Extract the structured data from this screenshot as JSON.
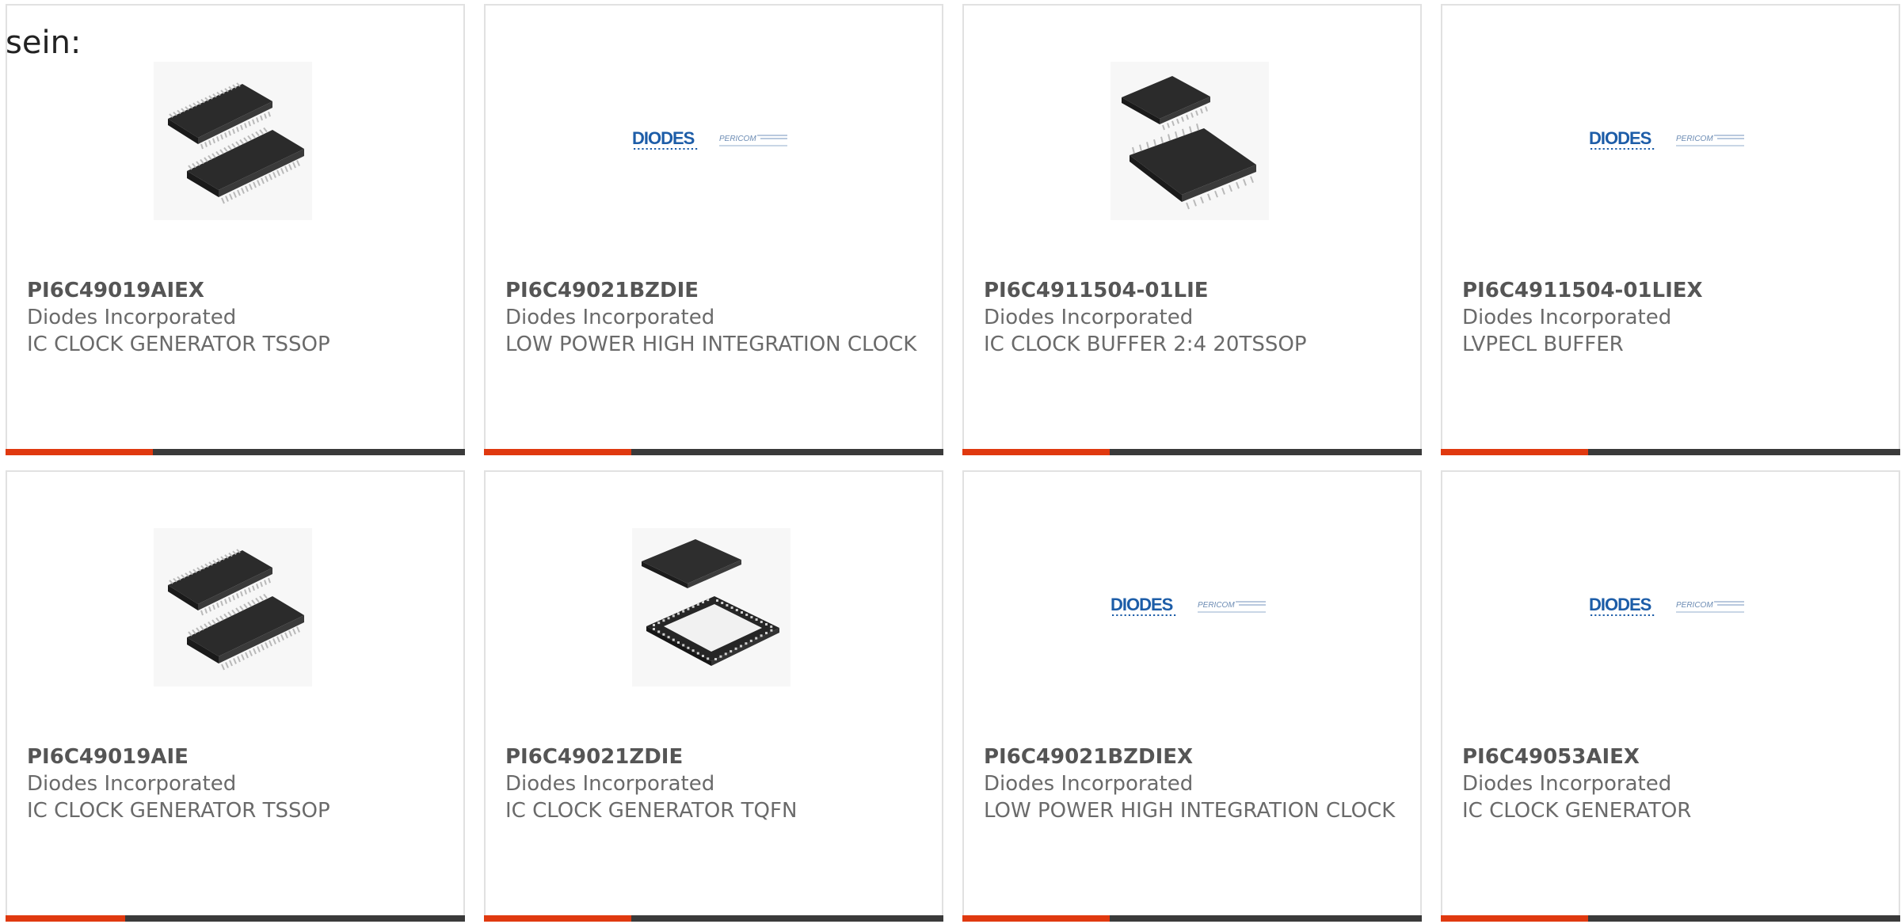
{
  "intro_text": "sein:",
  "colors": {
    "accent": "#e0390f",
    "bar": "#3a3a3a",
    "border": "#e1e1e1",
    "text": "#6a6a6a",
    "diodes_blue": "#1d5da8"
  },
  "cards": [
    {
      "part_number": "PI6C49019AIEX",
      "manufacturer": "Diodes Incorporated",
      "description": "IC CLOCK GENERATOR TSSOP",
      "image": "tssop-chip-pair",
      "progress": 0.32
    },
    {
      "part_number": "PI6C49021BZDIE",
      "manufacturer": "Diodes Incorporated",
      "description": "LOW POWER HIGH INTEGRATION CLOCK",
      "image": "diodes-pericom-logo",
      "progress": 0.32
    },
    {
      "part_number": "PI6C4911504-01LIE",
      "manufacturer": "Diodes Incorporated",
      "description": "IC CLOCK BUFFER 2:4 20TSSOP",
      "image": "small-tssop-chip-pair",
      "progress": 0.32
    },
    {
      "part_number": "PI6C4911504-01LIEX",
      "manufacturer": "Diodes Incorporated",
      "description": "LVPECL BUFFER",
      "image": "diodes-pericom-logo",
      "progress": 0.32
    },
    {
      "part_number": "PI6C49019AIE",
      "manufacturer": "Diodes Incorporated",
      "description": "IC CLOCK GENERATOR TSSOP",
      "image": "tssop-chip-pair",
      "progress": 0.26
    },
    {
      "part_number": "PI6C49021ZDIE",
      "manufacturer": "Diodes Incorporated",
      "description": "IC CLOCK GENERATOR TQFN",
      "image": "tqfn-chip-pair",
      "progress": 0.32
    },
    {
      "part_number": "PI6C49021BZDIEX",
      "manufacturer": "Diodes Incorporated",
      "description": "LOW POWER HIGH INTEGRATION CLOCK",
      "image": "diodes-pericom-logo",
      "progress": 0.32
    },
    {
      "part_number": "PI6C49053AIEX",
      "manufacturer": "Diodes Incorporated",
      "description": "IC CLOCK GENERATOR",
      "image": "diodes-pericom-logo",
      "progress": 0.32
    }
  ]
}
